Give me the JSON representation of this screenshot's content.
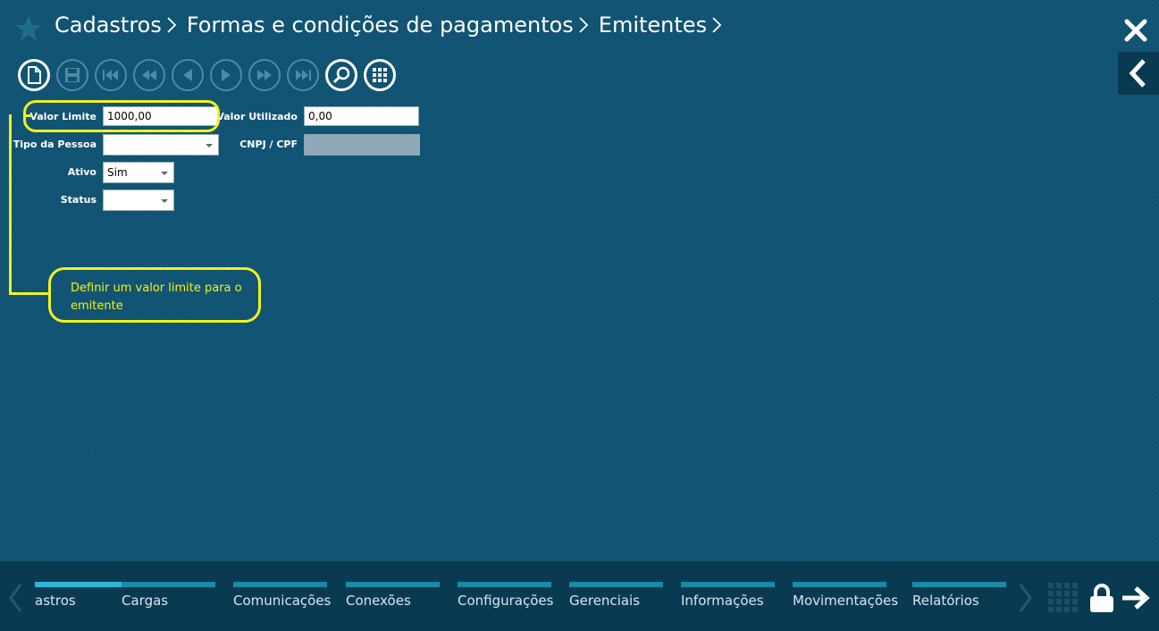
{
  "breadcrumb": [
    "Cadastros",
    "Formas e condições de pagamentos",
    "Emitentes"
  ],
  "form": {
    "valor_limite": {
      "label": "Valor Limite",
      "value": "1000,00"
    },
    "valor_utilizado": {
      "label": "Valor Utilizado",
      "value": "0,00"
    },
    "tipo_pessoa": {
      "label": "Tipo da Pessoa",
      "value": ""
    },
    "cnpj_cpf": {
      "label": "CNPJ / CPF",
      "value": ""
    },
    "ativo": {
      "label": "Ativo",
      "value": "Sim"
    },
    "status": {
      "label": "Status",
      "value": ""
    }
  },
  "callout": {
    "text": "Definir um valor limite para o emitente"
  },
  "bottom_nav": [
    "astros",
    "Cargas",
    "Comunicações",
    "Conexões",
    "Configurações",
    "Gerenciais",
    "Informações",
    "Movimentações",
    "Relatórios"
  ],
  "colors": {
    "background": "#0f5373",
    "bottom_bar": "#0a3a52",
    "highlight": "#f2f21a",
    "tab_accent": "#2db6d8"
  },
  "icons": [
    "star-icon",
    "chevron-right-icon",
    "close-icon",
    "chevron-left-icon",
    "new-document-icon",
    "save-icon",
    "first-record-icon",
    "rewind-icon",
    "previous-icon",
    "next-icon",
    "fast-forward-icon",
    "last-record-icon",
    "search-icon",
    "grid-icon",
    "lock-icon",
    "arrow-right-icon"
  ]
}
